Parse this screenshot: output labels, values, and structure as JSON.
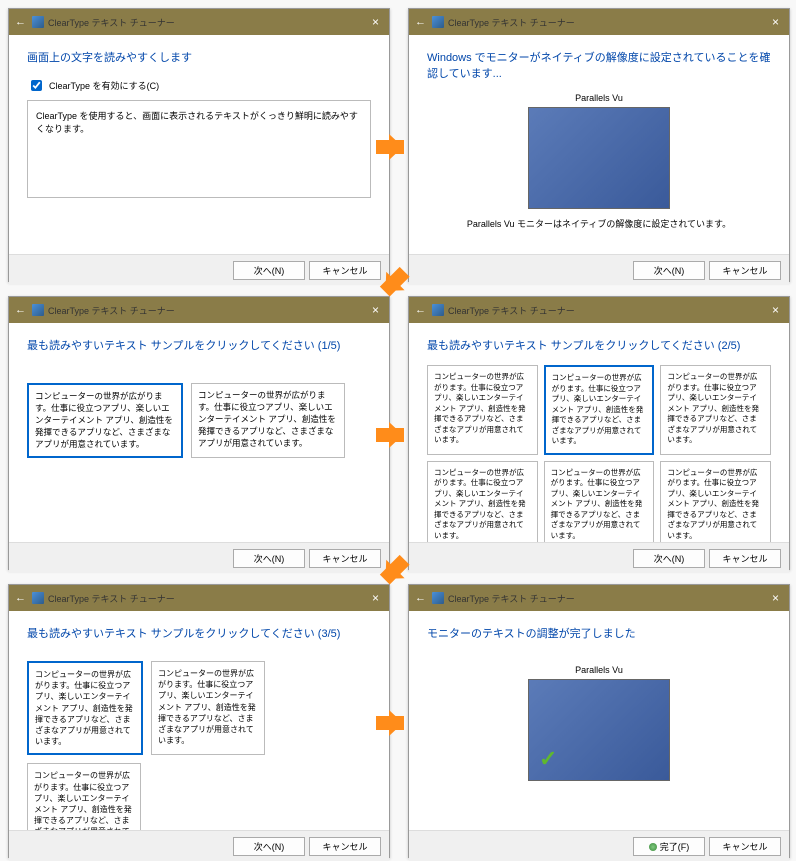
{
  "app_title": "ClearType テキスト チューナー",
  "buttons": {
    "next": "次へ(N)",
    "cancel": "キャンセル",
    "finish": "完了(F)"
  },
  "p1": {
    "heading": "画面上の文字を読みやすくします",
    "checkbox_label": "ClearType を有効にする(C)",
    "info": "ClearType を使用すると、画面に表示されるテキストがくっきり鮮明に読みやすくなります。"
  },
  "p2": {
    "heading": "Windows でモニターがネイティブの解像度に設定されていることを確認しています...",
    "monitor_label": "Parallels Vu",
    "status": "Parallels Vu モニターはネイティブの解像度に設定されています。"
  },
  "p3": {
    "heading": "最も読みやすいテキスト サンプルをクリックしてください (1/5)",
    "sample": "コンピューターの世界が広がります。仕事に役立つアプリ、楽しいエンターテイメント アプリ、創造性を発揮できるアプリなど、さまざまなアプリが用意されています。"
  },
  "p4": {
    "heading": "最も読みやすいテキスト サンプルをクリックしてください (2/5)",
    "sample": "コンピューターの世界が広がります。仕事に役立つアプリ、楽しいエンターテイメント アプリ、創造性を発揮できるアプリなど、さまざまなアプリが用意されています。"
  },
  "p5": {
    "heading": "最も読みやすいテキスト サンプルをクリックしてください (3/5)",
    "sample": "コンピューターの世界が広がります。仕事に役立つアプリ、楽しいエンターテイメント アプリ、創造性を発揮できるアプリなど、さまざまなアプリが用意されています。"
  },
  "p6": {
    "heading": "モニターのテキストの調整が完了しました",
    "monitor_label": "Parallels Vu"
  }
}
